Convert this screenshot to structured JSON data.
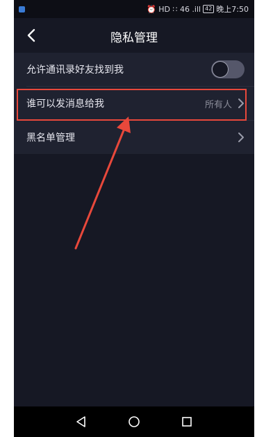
{
  "status_bar": {
    "right_text": "⏰ HD ∷ 46 .ill",
    "battery": "42",
    "time": "晚上7:50"
  },
  "nav": {
    "title": "隐私管理"
  },
  "rows": {
    "allow_find": {
      "label": "允许通讯录好友找到我",
      "toggle_on": false
    },
    "who_can_message": {
      "label": "谁可以发消息给我",
      "value": "所有人"
    },
    "blacklist": {
      "label": "黑名单管理"
    }
  },
  "annotation": {
    "color": "#e8483b"
  },
  "icons": [
    "back-arrow-icon",
    "chevron-right-icon",
    "triangle-back-icon",
    "circle-home-icon",
    "square-recents-icon"
  ]
}
